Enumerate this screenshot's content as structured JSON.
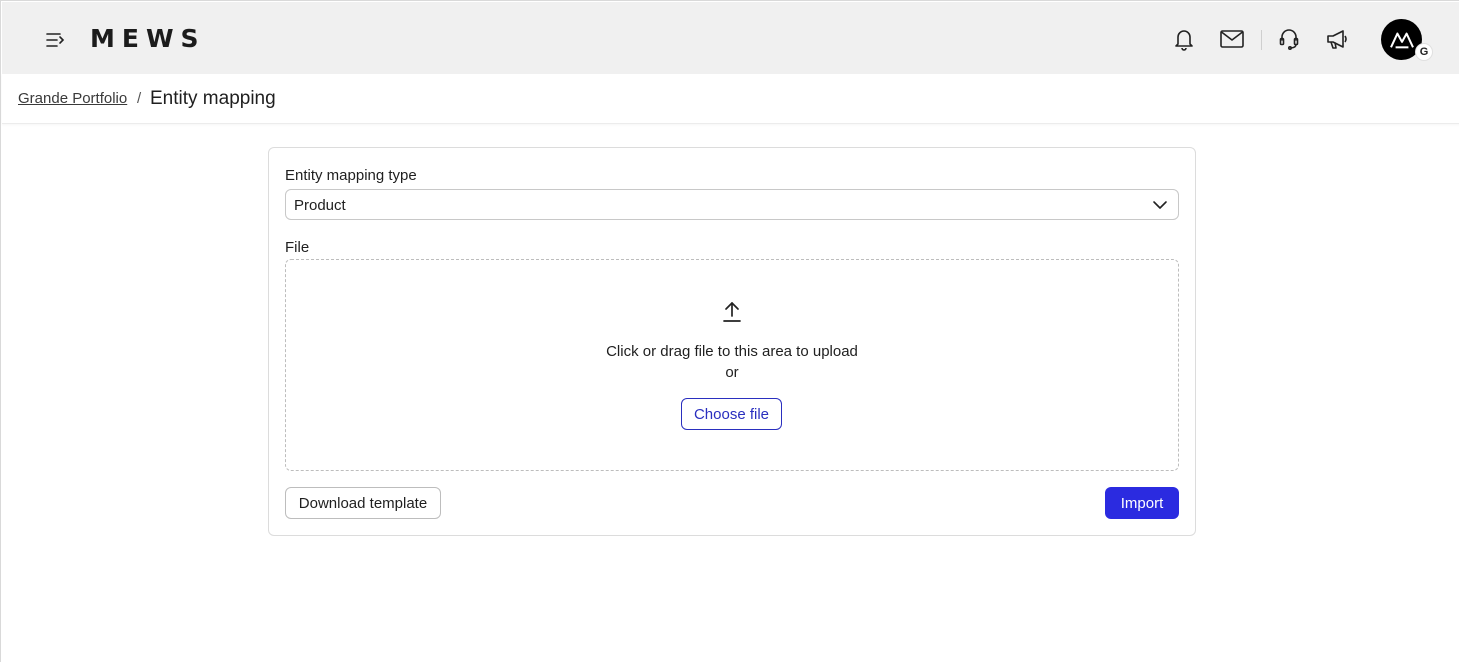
{
  "header": {
    "logo": "MEWS",
    "avatar_badge": "G",
    "icons": [
      "menu-collapse-icon",
      "bell-icon",
      "mail-icon",
      "headset-icon",
      "megaphone-icon"
    ]
  },
  "breadcrumb": {
    "parent": "Grande Portfolio",
    "separator": "/",
    "current": "Entity mapping"
  },
  "form": {
    "type_label": "Entity mapping type",
    "type_value": "Product",
    "file_label": "File",
    "drop_text": "Click or drag file to this area to upload",
    "or_text": "or",
    "choose_label": "Choose file",
    "download_label": "Download template",
    "import_label": "Import"
  },
  "colors": {
    "primary": "#2b2be0",
    "outline": "#2a2fbf",
    "topbar": "#f0f0f0"
  }
}
